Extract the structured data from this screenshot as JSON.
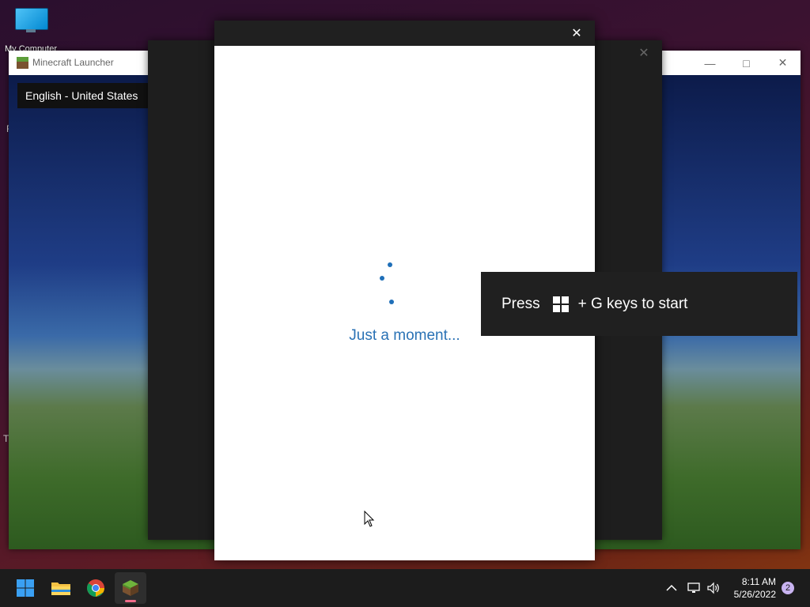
{
  "desktop": {
    "icons": [
      {
        "label": "My Computer",
        "icon": "computer-icon"
      }
    ],
    "side_letters": [
      "R",
      "Tr"
    ]
  },
  "launcher_window": {
    "title": "Minecraft Launcher",
    "language_selector": "English - United States",
    "controls": {
      "minimize": "—",
      "maximize": "□",
      "close": "✕"
    }
  },
  "middle_dialog": {
    "close": "✕"
  },
  "signin_dialog": {
    "close": "✕",
    "loading_text": "Just a moment..."
  },
  "gamebar_toast": {
    "prefix": "Press",
    "suffix": "+ G keys to start",
    "icon": "windows-logo-icon"
  },
  "taskbar": {
    "apps": [
      {
        "name": "Start",
        "icon": "windows-start-icon"
      },
      {
        "name": "File Explorer",
        "icon": "folder-icon"
      },
      {
        "name": "Google Chrome",
        "icon": "chrome-icon"
      },
      {
        "name": "Minecraft Launcher",
        "icon": "minecraft-icon",
        "active": true
      }
    ],
    "tray": {
      "chevron": "^",
      "time": "8:11 AM",
      "date": "5/26/2022",
      "notification_count": "2"
    }
  },
  "colors": {
    "accent_blue": "#2a72b5",
    "toast_bg": "#202020",
    "taskbar_bg": "#1c1c1c",
    "indicator": "#f06b8a"
  }
}
